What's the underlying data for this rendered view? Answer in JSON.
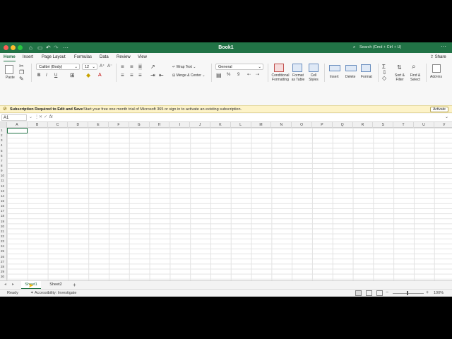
{
  "window": {
    "title": "Book1",
    "search_placeholder": "Search (Cmd + Ctrl + U)"
  },
  "colors": {
    "brand": "#217346",
    "close": "#fe5f57",
    "minimize": "#febc2e",
    "maximize": "#28c840",
    "banner": "#fdf3c8"
  },
  "tabs": [
    "Home",
    "Insert",
    "Page Layout",
    "Formulas",
    "Data",
    "Review",
    "View"
  ],
  "share_label": "Share",
  "ribbon": {
    "paste": "Paste",
    "font_name": "Calibri (Body)",
    "font_size": "12",
    "bold": "B",
    "italic": "I",
    "underline": "U",
    "wrap_text": "Wrap Text",
    "merge_center": "Merge & Center",
    "number_format": "General",
    "percent": "%",
    "comma": "9",
    "conditional_formatting": [
      "Conditional",
      "Formatting"
    ],
    "format_as_table": [
      "Format",
      "as Table"
    ],
    "cell_styles": [
      "Cell",
      "Styles"
    ],
    "insert": "Insert",
    "delete": "Delete",
    "format": "Format",
    "sort_filter": [
      "Sort &",
      "Filter"
    ],
    "find_select": [
      "Find &",
      "Select"
    ],
    "addins": "Add-ins"
  },
  "banner": {
    "title": "Subscription Required to Edit and Save",
    "message": "Start your free one month trial of Microsoft 365 or sign in to activate an existing subscription.",
    "button": "Activate"
  },
  "formula_bar": {
    "name_box": "A1",
    "fx": "fx"
  },
  "columns": [
    "A",
    "B",
    "C",
    "D",
    "E",
    "F",
    "G",
    "H",
    "I",
    "J",
    "K",
    "L",
    "M",
    "N",
    "O",
    "P",
    "Q",
    "R",
    "S",
    "T",
    "U",
    "V"
  ],
  "rows": [
    "1",
    "2",
    "3",
    "4",
    "5",
    "6",
    "7",
    "8",
    "9",
    "10",
    "11",
    "12",
    "13",
    "14",
    "15",
    "16",
    "17",
    "18",
    "19",
    "20",
    "21",
    "22",
    "23",
    "24",
    "25",
    "26",
    "27",
    "28",
    "29",
    "30",
    "31",
    "32",
    "33",
    "34"
  ],
  "sheets": [
    "Sheet1",
    "Sheet2"
  ],
  "status": {
    "ready": "Ready",
    "accessibility": "Accessibility: Investigate",
    "zoom": "100%"
  }
}
